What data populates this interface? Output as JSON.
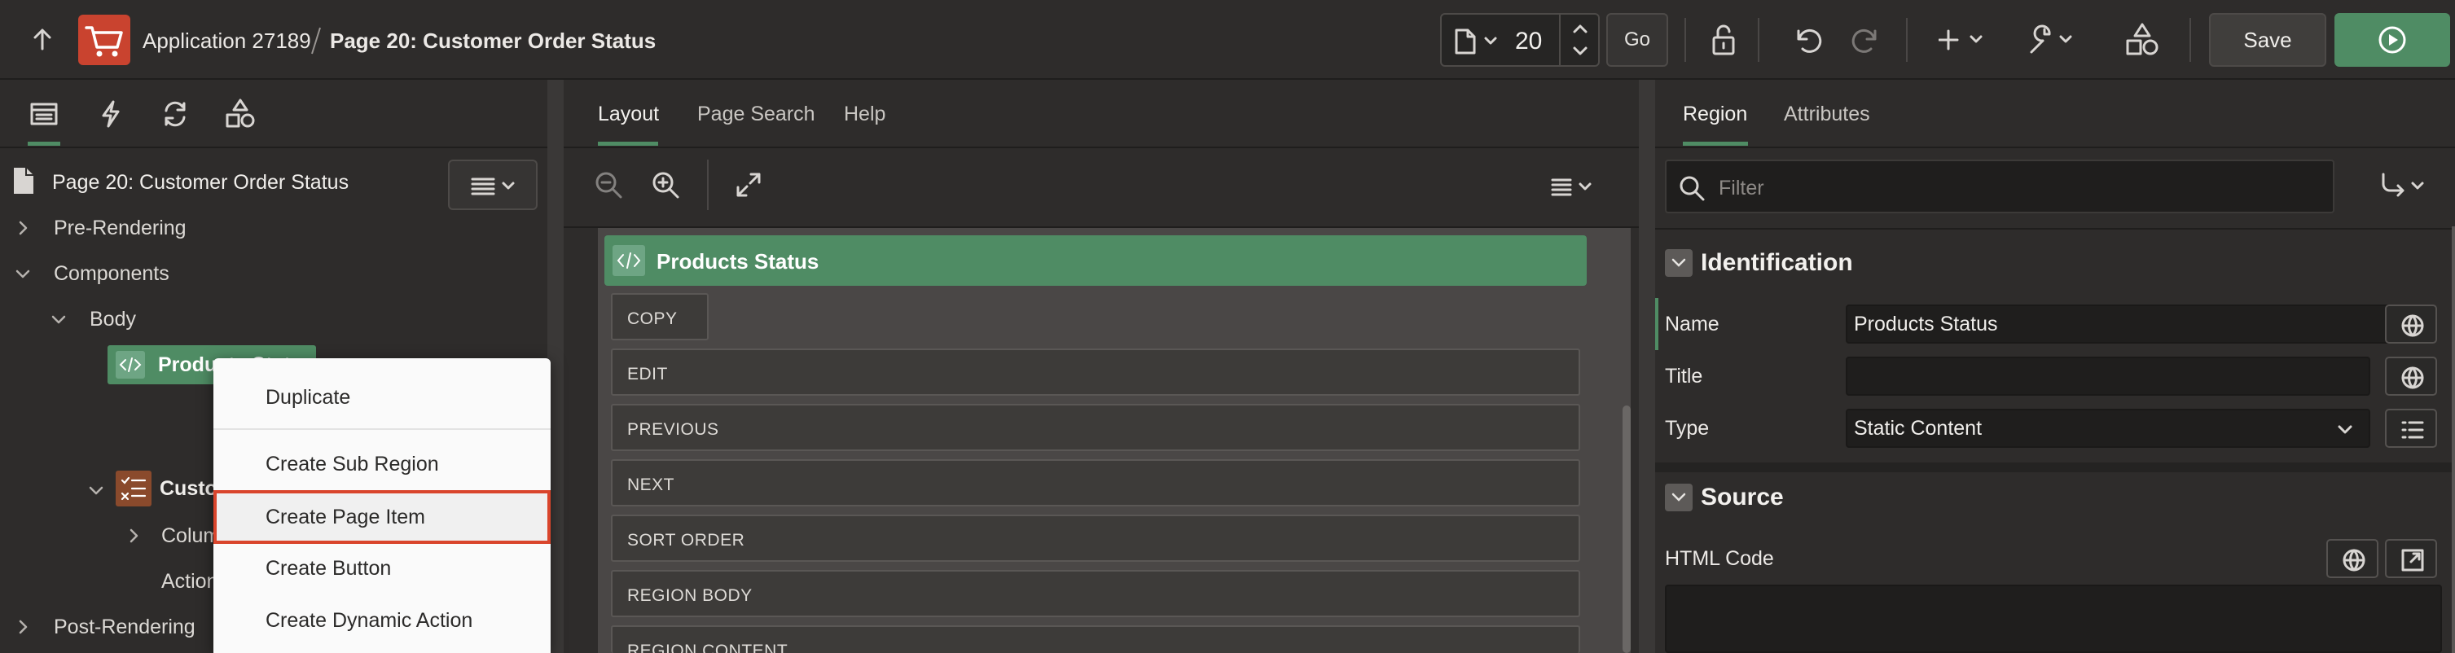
{
  "header": {
    "app_name": "Application 27189",
    "page_name": "Page 20: Customer Order Status",
    "page_number": "20",
    "go_label": "Go",
    "save_label": "Save"
  },
  "left_tabs": [
    "rendering-tab",
    "dynamic-actions-tab",
    "processing-tab",
    "shared-components-tab"
  ],
  "tree": {
    "page_title": "Page 20: Customer Order Status",
    "pre_rendering": "Pre-Rendering",
    "components": "Components",
    "body": "Body",
    "products_item": "Products Status",
    "customer_item": "Customer",
    "columns": "Columns",
    "actions": "Actions",
    "post_rendering": "Post-Rendering"
  },
  "context_menu": {
    "items": [
      "Duplicate",
      "Create Sub Region",
      "Create Page Item",
      "Create Button",
      "Create Dynamic Action"
    ],
    "highlighted": "Create Page Item"
  },
  "center": {
    "tabs": [
      "Layout",
      "Page Search",
      "Help"
    ],
    "active_tab": "Layout",
    "region_title": "Products Status",
    "positions": [
      "COPY",
      "EDIT",
      "PREVIOUS",
      "NEXT",
      "SORT ORDER",
      "REGION BODY",
      "REGION CONTENT"
    ]
  },
  "right": {
    "tabs": [
      "Region",
      "Attributes"
    ],
    "active_tab": "Region",
    "filter_placeholder": "Filter",
    "identification_title": "Identification",
    "name_label": "Name",
    "name_value": "Products Status",
    "title_label": "Title",
    "title_value": "",
    "type_label": "Type",
    "type_value": "Static Content",
    "source_title": "Source",
    "html_code_label": "HTML Code"
  },
  "colors": {
    "accent_green": "#4f8c64",
    "highlight_border": "#d9452c",
    "app_icon_bg": "#c9432f"
  }
}
